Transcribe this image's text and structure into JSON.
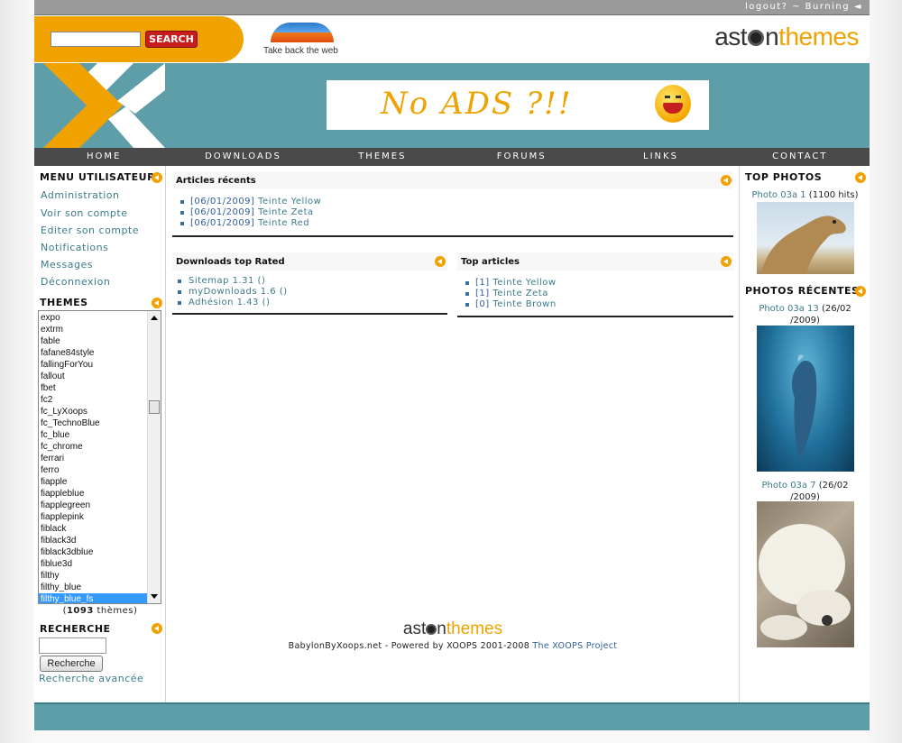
{
  "topbar": {
    "user_text": "logout? ~ Burning"
  },
  "header": {
    "search_button": "SEARCH",
    "firefox_tagline": "Take back the web",
    "logo_part1": "ast",
    "logo_part2": "n",
    "logo_part3": "themes"
  },
  "banner": {
    "ad_text": "No ADS ?!!"
  },
  "nav": [
    "HOME",
    "DOWNLOADS",
    "THEMES",
    "FORUMS",
    "LINKS",
    "CONTACT"
  ],
  "left": {
    "user_menu_title": "MENU UTILISATEUR",
    "user_menu": [
      "Administration",
      "Voir son compte",
      "Editer son compte",
      "Notifications",
      "Messages",
      "Déconnexion"
    ],
    "themes_title": "THEMES",
    "themes": [
      "expo",
      "extrm",
      "fable",
      "fafane84style",
      "fallingForYou",
      "fallout",
      "fbet",
      "fc2",
      "fc_LyXoops",
      "fc_TechnoBlue",
      "fc_blue",
      "fc_chrome",
      "ferrari",
      "ferro",
      "fiapple",
      "fiappleblue",
      "fiapplegreen",
      "fiapplepink",
      "fiblack",
      "fiblack3d",
      "fiblack3dblue",
      "fiblue3d",
      "filthy",
      "filthy_blue",
      "filthy_blue_fs"
    ],
    "themes_count": "1093",
    "themes_count_suffix": " thèmes)",
    "themes_count_prefix": "(",
    "search_title": "RECHERCHE",
    "search_button": "Recherche",
    "advanced_search": "Recherche avancée"
  },
  "center": {
    "recent_title": "Articles récents",
    "recent": [
      {
        "date": "[06/01/2009]",
        "title": "Teinte Yellow"
      },
      {
        "date": "[06/01/2009]",
        "title": "Teinte Zeta"
      },
      {
        "date": "[06/01/2009]",
        "title": "Teinte Red"
      }
    ],
    "downloads_title": "Downloads top Rated",
    "downloads": [
      "Sitemap 1.31 ()",
      "myDownloads 1.6 ()",
      "Adhésion 1.43 ()"
    ],
    "top_title": "Top articles",
    "top": [
      {
        "count": "[1]",
        "title": "Teinte Yellow"
      },
      {
        "count": "[1]",
        "title": "Teinte Zeta"
      },
      {
        "count": "[0]",
        "title": "Teinte Brown"
      }
    ],
    "footer_logo1": "ast",
    "footer_logo2": "n",
    "footer_logo3": "themes",
    "footer_text": "BabylonByXoops.net - Powered by XOOPS 2001-2008 ",
    "footer_link": "The XOOPS Project"
  },
  "right": {
    "top_photos_title": "TOP PHOTOS",
    "top_photo_name": "Photo 03a 1",
    "top_photo_hits": " (1100 hits)",
    "recent_title": "PHOTOS RÉCENTES",
    "recent_photo1_name": "Photo 03a 13",
    "recent_photo1_date": " (26/02",
    "recent_photo1_date2": "/2009)",
    "recent_photo2_name": "Photo 03a 7",
    "recent_photo2_date": " (26/02",
    "recent_photo2_date2": "/2009)"
  },
  "colors": {
    "accent": "#f0a200",
    "teal": "#5e9ea9",
    "nav": "#4a4a4a",
    "link": "#3b7a8a"
  }
}
